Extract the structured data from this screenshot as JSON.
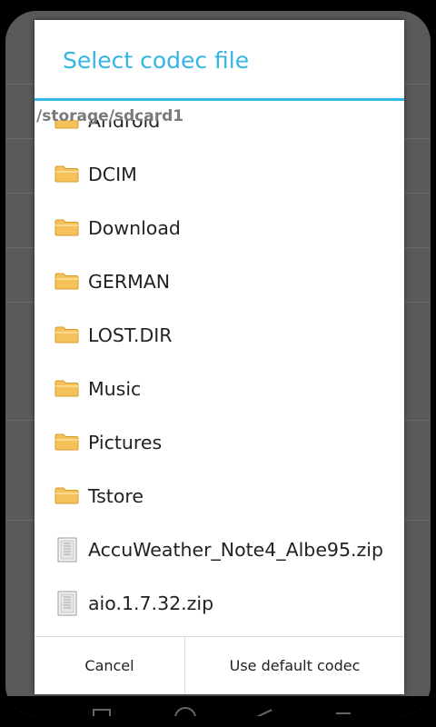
{
  "dialog": {
    "title": "Select codec file",
    "path": "/storage/sdcard1",
    "items": [
      {
        "label": "Android",
        "type": "folder"
      },
      {
        "label": "DCIM",
        "type": "folder"
      },
      {
        "label": "Download",
        "type": "folder"
      },
      {
        "label": "GERMAN",
        "type": "folder"
      },
      {
        "label": "LOST.DIR",
        "type": "folder"
      },
      {
        "label": "Music",
        "type": "folder"
      },
      {
        "label": "Pictures",
        "type": "folder"
      },
      {
        "label": "Tstore",
        "type": "folder"
      },
      {
        "label": "AccuWeather_Note4_Albe95.zip",
        "type": "file"
      },
      {
        "label": "aio.1.7.32.zip",
        "type": "file"
      }
    ],
    "buttons": {
      "cancel": "Cancel",
      "use_default": "Use default codec"
    }
  },
  "icons": {
    "folder": "folder-icon",
    "file": "zip-file-icon"
  },
  "colors": {
    "accent": "#33b5e5",
    "folder": "#f5c15a"
  }
}
